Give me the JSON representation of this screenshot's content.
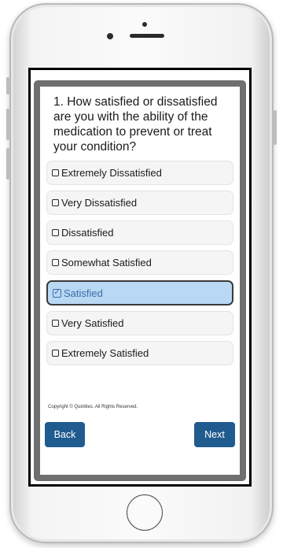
{
  "survey": {
    "question": "1. How satisfied or dissatisfied are you with the ability of the medication to prevent or treat your condition?",
    "options": [
      {
        "label": "Extremely Dissatisfied",
        "selected": false
      },
      {
        "label": "Very Dissatisfied",
        "selected": false
      },
      {
        "label": "Dissatisfied",
        "selected": false
      },
      {
        "label": "Somewhat Satisfied",
        "selected": false
      },
      {
        "label": "Satisfied",
        "selected": true
      },
      {
        "label": "Very Satisfied",
        "selected": false
      },
      {
        "label": "Extremely Satisfied",
        "selected": false
      }
    ],
    "copyright": "Copyright © Quintiles. All Rights Reserved."
  },
  "navigation": {
    "back_label": "Back",
    "next_label": "Next"
  },
  "colors": {
    "button_bg": "#1f5b8e",
    "selected_bg": "#b8d8f3",
    "selected_text": "#3c6ea8",
    "frame": "#6f6f6f"
  },
  "icons": {
    "unchecked": "checkbox-empty-icon",
    "checked": "checkbox-checked-icon"
  }
}
